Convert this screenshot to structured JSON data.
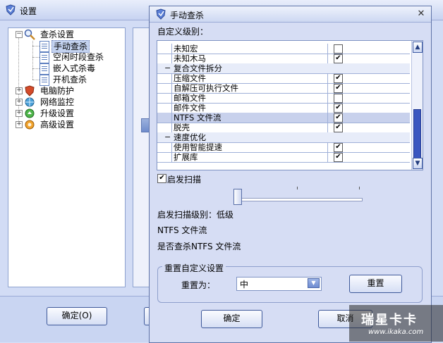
{
  "settings_window": {
    "title": "设置",
    "tree": {
      "scan": "查杀设置",
      "manual": "手动查杀",
      "idle": "空闲时段查杀",
      "embedded": "嵌入式杀毒",
      "boot": "开机查杀",
      "pc_protect": "电脑防护",
      "net_monitor": "网络监控",
      "upgrade": "升级设置",
      "advanced": "高级设置"
    },
    "ok_label": "确定(O)"
  },
  "dialog": {
    "title": "手动查杀",
    "custom_level_label": "自定义级别：",
    "grid_rows": [
      {
        "name": "未知宏",
        "checked": false,
        "type": "item"
      },
      {
        "name": "未知木马",
        "checked": true,
        "type": "item"
      },
      {
        "name": "复合文件拆分",
        "type": "group"
      },
      {
        "name": "压缩文件",
        "checked": true,
        "type": "item"
      },
      {
        "name": "自解压可执行文件",
        "checked": true,
        "type": "item"
      },
      {
        "name": "邮箱文件",
        "checked": false,
        "type": "item"
      },
      {
        "name": "邮件文件",
        "checked": true,
        "type": "item"
      },
      {
        "name": "NTFS 文件流",
        "checked": true,
        "type": "item",
        "selected": true
      },
      {
        "name": "脱壳",
        "checked": true,
        "type": "item"
      },
      {
        "name": "速度优化",
        "type": "group"
      },
      {
        "name": "使用智能提速",
        "checked": true,
        "type": "item"
      },
      {
        "name": "扩展库",
        "checked": true,
        "type": "item"
      }
    ],
    "heuristic_scan_label": "启发扫描",
    "heuristic_scan_checked": true,
    "heuristic_level_value": 0,
    "heuristic_level_text": "启发扫描级别：低级",
    "info_title": "NTFS 文件流",
    "info_desc": "是否查杀NTFS 文件流",
    "reset_group_title": "重置自定义设置",
    "reset_to_label": "重置为：",
    "reset_to_value": "中",
    "reset_button": "重置",
    "ok_button": "确定",
    "cancel_button": "取消"
  },
  "watermark": {
    "logo": "瑞星卡卡",
    "url": "www.ikaka.com"
  }
}
